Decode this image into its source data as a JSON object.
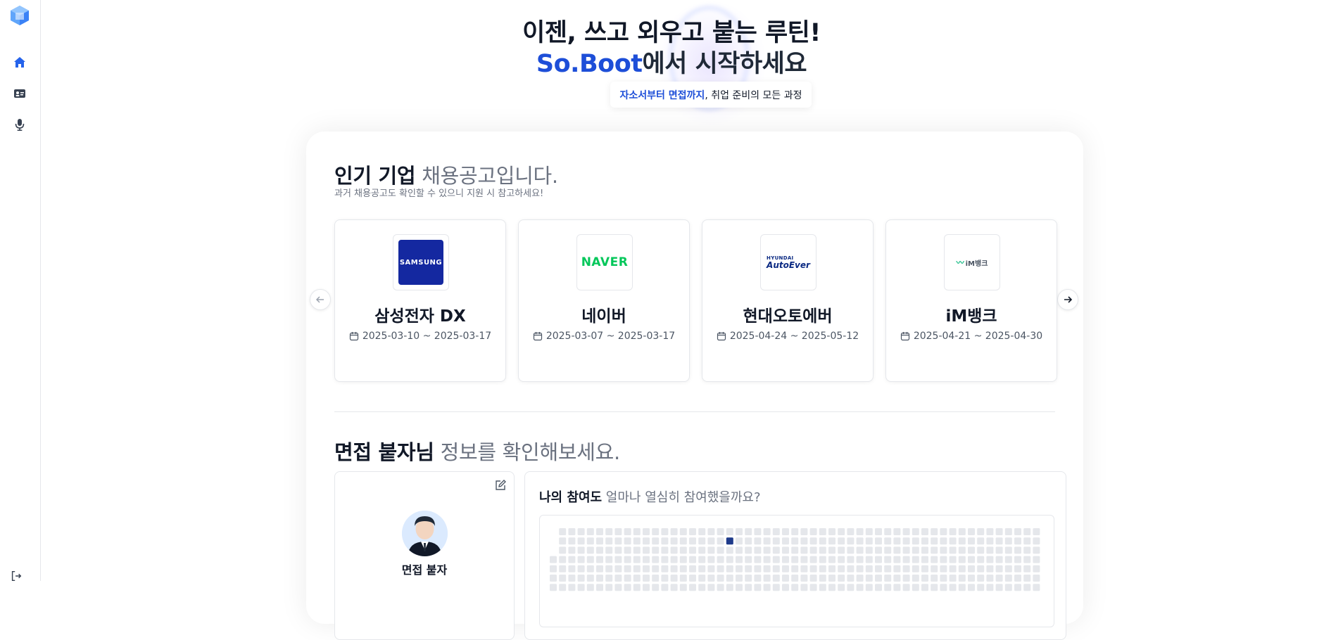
{
  "sidebar": {
    "items": [
      {
        "name": "home",
        "icon": "home-icon",
        "active": true
      },
      {
        "name": "resume",
        "icon": "id-card-icon",
        "active": false
      },
      {
        "name": "interview",
        "icon": "microphone-icon",
        "active": false
      }
    ],
    "logout_icon": "logout-icon"
  },
  "hero": {
    "line1": "이젠, 쓰고 외우고 붙는 루틴!",
    "brand": "So.Boot",
    "line2_rest": "에서 시작하세요",
    "pill_highlight": "자소서부터 면접까지",
    "pill_rest": ", 취업 준비의 모든 과정"
  },
  "jobs": {
    "title_strong": "인기 기업",
    "title_muted": " 채용공고입니다.",
    "subtitle": "과거 채용공고도 확인할 수 있으니 지원 시 참고하세요!",
    "cards": [
      {
        "name": "삼성전자 DX",
        "dates": "2025-03-10 ~ 2025-03-17",
        "logo_text": "SAMSUNG"
      },
      {
        "name": "네이버",
        "dates": "2025-03-07 ~ 2025-03-17",
        "logo_text": "NAVER"
      },
      {
        "name": "현대오토에버",
        "dates": "2025-04-24 ~ 2025-05-12",
        "logo_small": "HYUNDAI",
        "logo_big": "AutoEver"
      },
      {
        "name": "iM뱅크",
        "dates": "2025-04-21 ~ 2025-04-30",
        "logo_text": "iM뱅크"
      }
    ]
  },
  "interview": {
    "title_strong": "면접 붙자님",
    "title_muted": " 정보를 확인해보세요.",
    "profile_name": "면접 붙자",
    "participation_strong": "나의 참여도",
    "participation_muted": " 얼마나 열심히 참여했을까요?"
  },
  "colors": {
    "brand_blue": "#1d4ed8",
    "samsung_blue": "#1428a0",
    "naver_green": "#03c75a",
    "grid_empty": "#e5e7eb",
    "grid_active": "#1e3a8a"
  }
}
